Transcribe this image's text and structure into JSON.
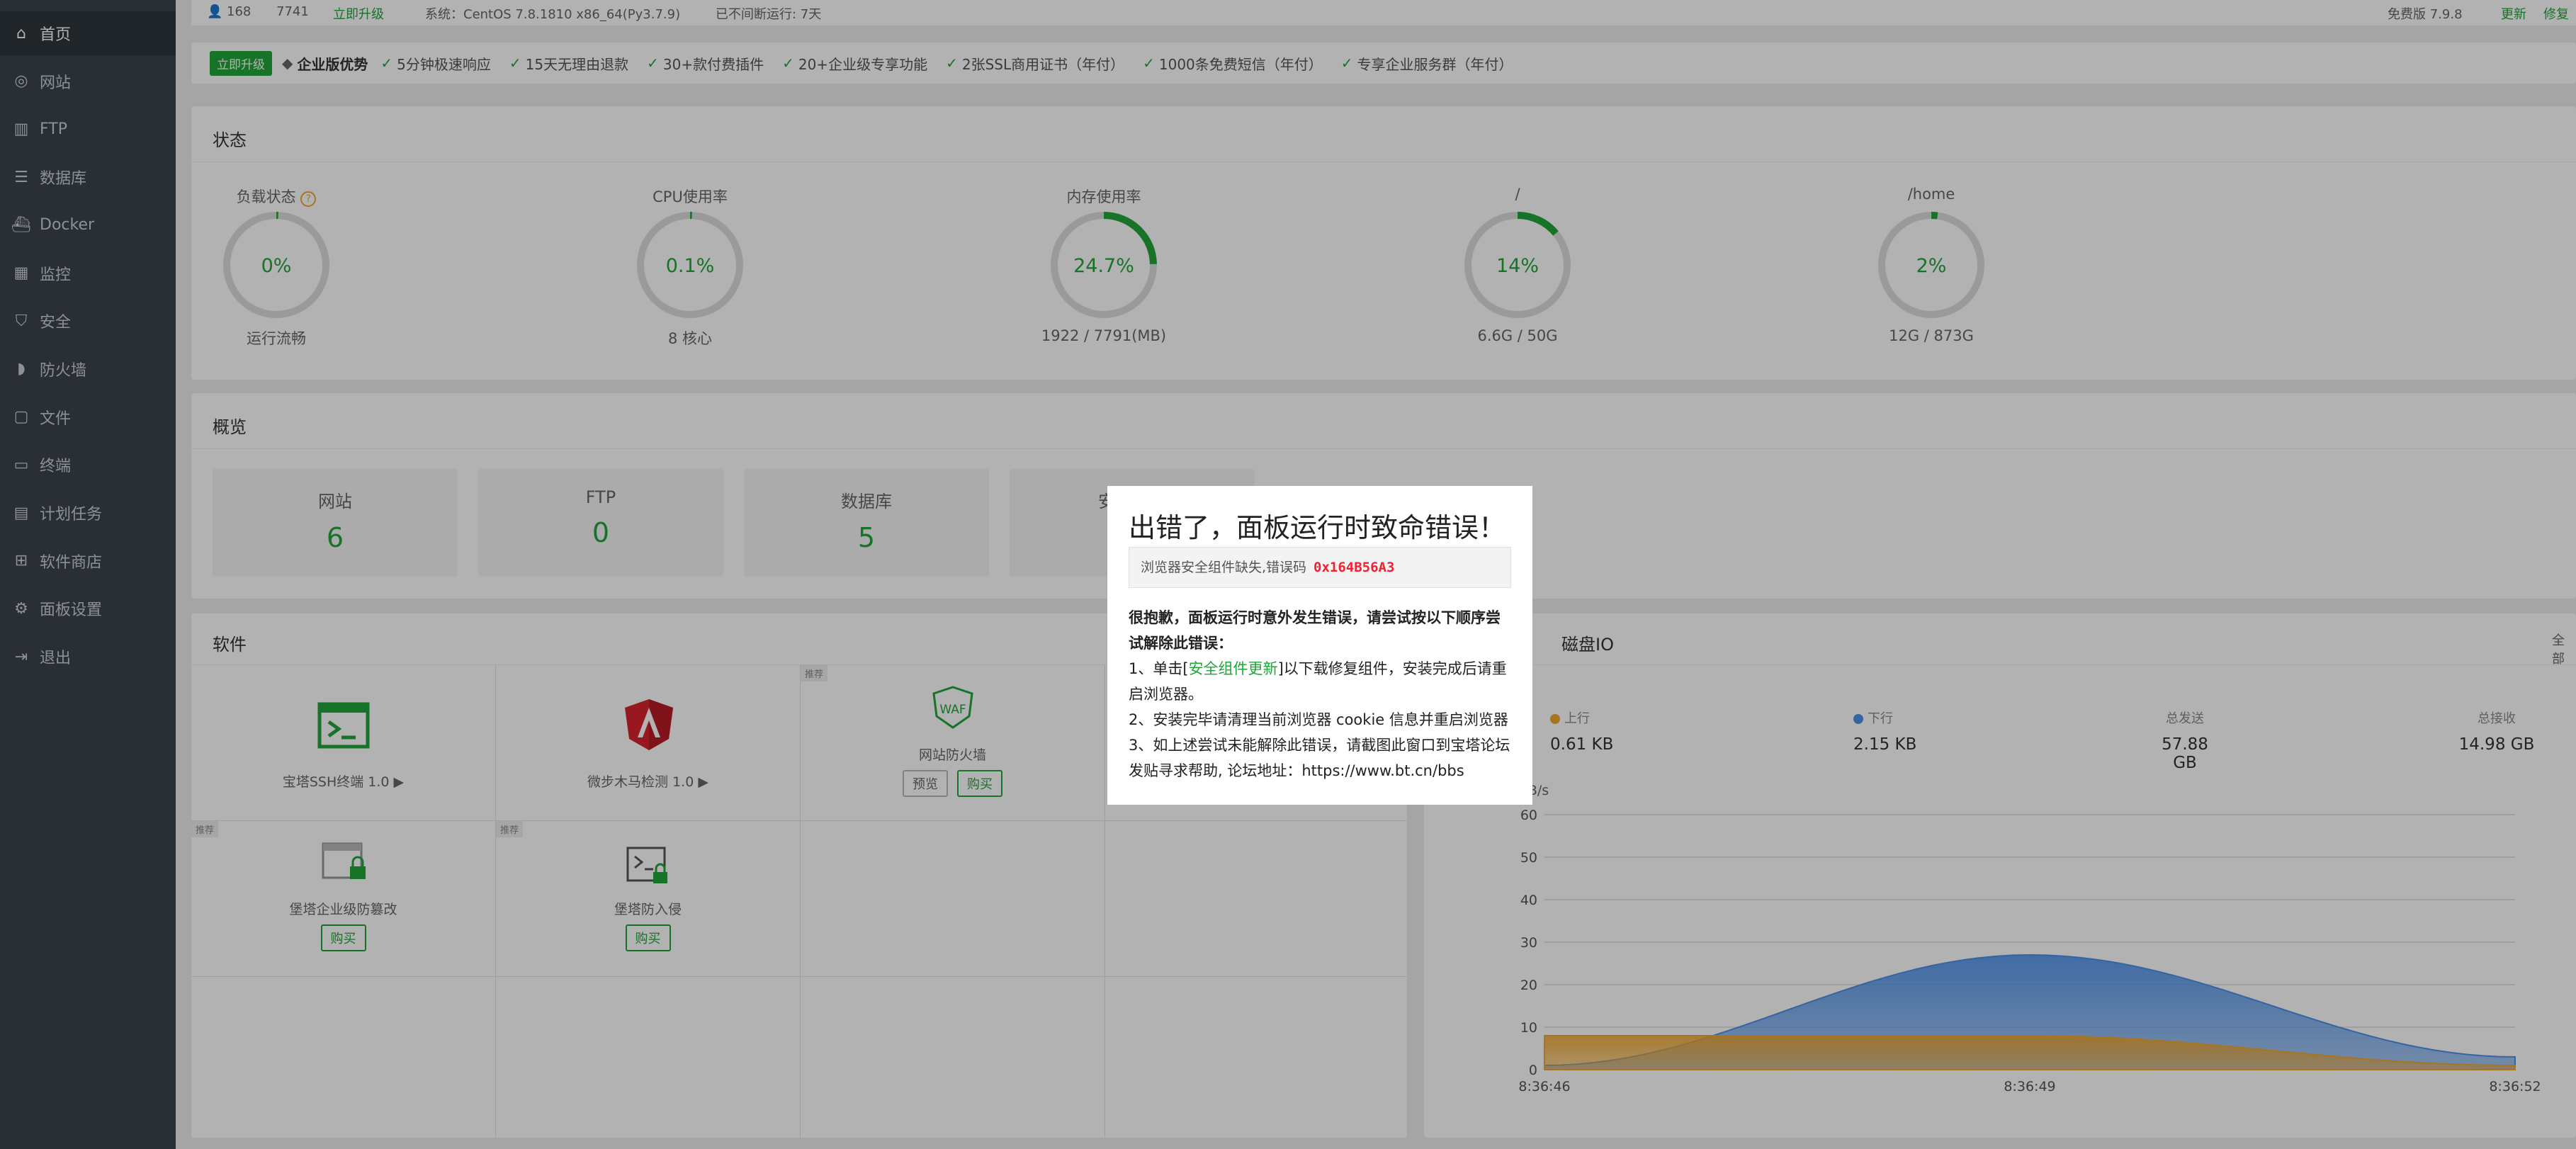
{
  "sidebar": {
    "items": [
      {
        "label": "首页",
        "icon": "home-icon"
      },
      {
        "label": "网站",
        "icon": "globe-icon"
      },
      {
        "label": "FTP",
        "icon": "ftp-icon"
      },
      {
        "label": "数据库",
        "icon": "database-icon"
      },
      {
        "label": "Docker",
        "icon": "docker-icon"
      },
      {
        "label": "监控",
        "icon": "monitor-icon"
      },
      {
        "label": "安全",
        "icon": "shield-icon"
      },
      {
        "label": "防火墙",
        "icon": "firewall-icon"
      },
      {
        "label": "文件",
        "icon": "folder-icon"
      },
      {
        "label": "终端",
        "icon": "terminal-icon"
      },
      {
        "label": "计划任务",
        "icon": "calendar-icon"
      },
      {
        "label": "软件商店",
        "icon": "apps-icon"
      },
      {
        "label": "面板设置",
        "icon": "gear-icon"
      },
      {
        "label": "退出",
        "icon": "logout-icon"
      }
    ]
  },
  "topbar": {
    "user": "168",
    "count": "7741",
    "status": "立即升级",
    "system": "系统：CentOS 7.8.1810 x86_64(Py3.7.9)",
    "uptime": "已不间断运行: 7天",
    "version_label": "免费版 7.9.8",
    "update": "更新",
    "fix": "修复"
  },
  "promo": {
    "upgrade_button": "立即升级",
    "title": "企业版优势",
    "features": [
      "5分钟极速响应",
      "15天无理由退款",
      "30+款付费插件",
      "20+企业级专享功能",
      "2张SSL商用证书（年付）",
      "1000条免费短信（年付）",
      "专享企业服务群（年付）"
    ]
  },
  "status": {
    "title": "状态",
    "gauges": [
      {
        "label": "负载状态",
        "value": "0%",
        "percent": 0,
        "foot": "运行流畅",
        "help": "?"
      },
      {
        "label": "CPU使用率",
        "value": "0.1%",
        "percent": 0.1,
        "foot": "8 核心"
      },
      {
        "label": "内存使用率",
        "value": "24.7%",
        "percent": 24.7,
        "foot": "1922 / 7791(MB)"
      },
      {
        "label": "/",
        "value": "14%",
        "percent": 14,
        "foot": "6.6G / 50G"
      },
      {
        "label": "/home",
        "value": "2%",
        "percent": 2,
        "foot": "12G / 873G"
      }
    ]
  },
  "overview": {
    "title": "概览",
    "cards": [
      {
        "label": "网站",
        "value": "6"
      },
      {
        "label": "FTP",
        "value": "0"
      },
      {
        "label": "数据库",
        "value": "5"
      },
      {
        "label": "安全风险",
        "value": ""
      }
    ]
  },
  "software": {
    "title": "软件",
    "recommend_tag": "推荐",
    "preview": "预览",
    "buy": "购买",
    "items": [
      {
        "name": "宝塔SSH终端 1.0 ▶"
      },
      {
        "name": "微步木马检测 1.0 ▶"
      },
      {
        "name": "网站防火墙"
      },
      {
        "name": "堡塔企业级防篡改"
      },
      {
        "name": "堡塔防入侵"
      }
    ]
  },
  "disk_io": {
    "title": "磁盘IO",
    "all_label": "全部",
    "stats": [
      {
        "label": "上行",
        "value": "0.61 KB",
        "color": "#f0a830"
      },
      {
        "label": "下行",
        "value": "2.15 KB",
        "color": "#4d90e8"
      },
      {
        "label": "总发送",
        "value": "57.88 GB"
      },
      {
        "label": "总接收",
        "value": "14.98 GB"
      }
    ]
  },
  "chart_data": {
    "type": "area",
    "ylabel": "单位:KB/s",
    "ylim": [
      0,
      60
    ],
    "yticks": [
      0,
      10,
      20,
      30,
      40,
      50,
      60
    ],
    "x": [
      "8:36:46",
      "8:36:49",
      "8:36:52"
    ],
    "series": [
      {
        "name": "下行",
        "color": "#4d90e8",
        "values": [
          1,
          27,
          3
        ]
      },
      {
        "name": "上行",
        "color": "#f0a830",
        "values": [
          8,
          8,
          1
        ]
      }
    ]
  },
  "modal": {
    "title": "出错了，面板运行时致命错误！",
    "error_text": "浏览器安全组件缺失,错误码",
    "error_code": "0x164B56A3",
    "intro": "很抱歉，面板运行时意外发生错误，请尝试按以下顺序尝试解除此错误：",
    "step1_a": "1、单击[",
    "step1_link": "安全组件更新",
    "step1_b": "]以下载修复组件，安装完成后请重启浏览器。",
    "step2": "2、安装完毕请清理当前浏览器 cookie 信息并重启浏览器",
    "step3": "3、如上述尝试未能解除此错误，请截图此窗口到宝塔论坛发贴寻求帮助, 论坛地址：https://www.bt.cn/bbs"
  }
}
